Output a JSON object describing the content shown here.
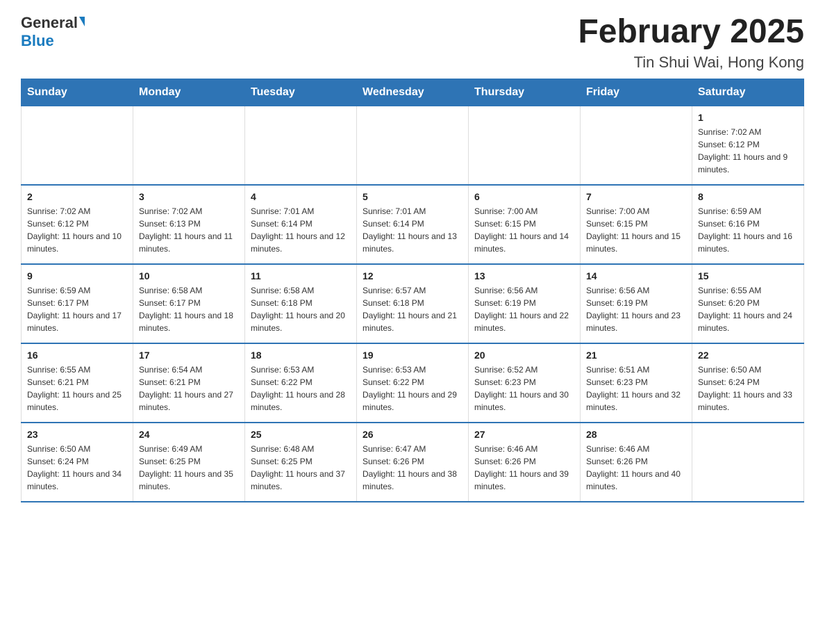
{
  "header": {
    "logo_general": "General",
    "logo_blue": "Blue",
    "title": "February 2025",
    "subtitle": "Tin Shui Wai, Hong Kong"
  },
  "weekdays": [
    "Sunday",
    "Monday",
    "Tuesday",
    "Wednesday",
    "Thursday",
    "Friday",
    "Saturday"
  ],
  "weeks": [
    [
      {
        "day": "",
        "info": ""
      },
      {
        "day": "",
        "info": ""
      },
      {
        "day": "",
        "info": ""
      },
      {
        "day": "",
        "info": ""
      },
      {
        "day": "",
        "info": ""
      },
      {
        "day": "",
        "info": ""
      },
      {
        "day": "1",
        "info": "Sunrise: 7:02 AM\nSunset: 6:12 PM\nDaylight: 11 hours and 9 minutes."
      }
    ],
    [
      {
        "day": "2",
        "info": "Sunrise: 7:02 AM\nSunset: 6:12 PM\nDaylight: 11 hours and 10 minutes."
      },
      {
        "day": "3",
        "info": "Sunrise: 7:02 AM\nSunset: 6:13 PM\nDaylight: 11 hours and 11 minutes."
      },
      {
        "day": "4",
        "info": "Sunrise: 7:01 AM\nSunset: 6:14 PM\nDaylight: 11 hours and 12 minutes."
      },
      {
        "day": "5",
        "info": "Sunrise: 7:01 AM\nSunset: 6:14 PM\nDaylight: 11 hours and 13 minutes."
      },
      {
        "day": "6",
        "info": "Sunrise: 7:00 AM\nSunset: 6:15 PM\nDaylight: 11 hours and 14 minutes."
      },
      {
        "day": "7",
        "info": "Sunrise: 7:00 AM\nSunset: 6:15 PM\nDaylight: 11 hours and 15 minutes."
      },
      {
        "day": "8",
        "info": "Sunrise: 6:59 AM\nSunset: 6:16 PM\nDaylight: 11 hours and 16 minutes."
      }
    ],
    [
      {
        "day": "9",
        "info": "Sunrise: 6:59 AM\nSunset: 6:17 PM\nDaylight: 11 hours and 17 minutes."
      },
      {
        "day": "10",
        "info": "Sunrise: 6:58 AM\nSunset: 6:17 PM\nDaylight: 11 hours and 18 minutes."
      },
      {
        "day": "11",
        "info": "Sunrise: 6:58 AM\nSunset: 6:18 PM\nDaylight: 11 hours and 20 minutes."
      },
      {
        "day": "12",
        "info": "Sunrise: 6:57 AM\nSunset: 6:18 PM\nDaylight: 11 hours and 21 minutes."
      },
      {
        "day": "13",
        "info": "Sunrise: 6:56 AM\nSunset: 6:19 PM\nDaylight: 11 hours and 22 minutes."
      },
      {
        "day": "14",
        "info": "Sunrise: 6:56 AM\nSunset: 6:19 PM\nDaylight: 11 hours and 23 minutes."
      },
      {
        "day": "15",
        "info": "Sunrise: 6:55 AM\nSunset: 6:20 PM\nDaylight: 11 hours and 24 minutes."
      }
    ],
    [
      {
        "day": "16",
        "info": "Sunrise: 6:55 AM\nSunset: 6:21 PM\nDaylight: 11 hours and 25 minutes."
      },
      {
        "day": "17",
        "info": "Sunrise: 6:54 AM\nSunset: 6:21 PM\nDaylight: 11 hours and 27 minutes."
      },
      {
        "day": "18",
        "info": "Sunrise: 6:53 AM\nSunset: 6:22 PM\nDaylight: 11 hours and 28 minutes."
      },
      {
        "day": "19",
        "info": "Sunrise: 6:53 AM\nSunset: 6:22 PM\nDaylight: 11 hours and 29 minutes."
      },
      {
        "day": "20",
        "info": "Sunrise: 6:52 AM\nSunset: 6:23 PM\nDaylight: 11 hours and 30 minutes."
      },
      {
        "day": "21",
        "info": "Sunrise: 6:51 AM\nSunset: 6:23 PM\nDaylight: 11 hours and 32 minutes."
      },
      {
        "day": "22",
        "info": "Sunrise: 6:50 AM\nSunset: 6:24 PM\nDaylight: 11 hours and 33 minutes."
      }
    ],
    [
      {
        "day": "23",
        "info": "Sunrise: 6:50 AM\nSunset: 6:24 PM\nDaylight: 11 hours and 34 minutes."
      },
      {
        "day": "24",
        "info": "Sunrise: 6:49 AM\nSunset: 6:25 PM\nDaylight: 11 hours and 35 minutes."
      },
      {
        "day": "25",
        "info": "Sunrise: 6:48 AM\nSunset: 6:25 PM\nDaylight: 11 hours and 37 minutes."
      },
      {
        "day": "26",
        "info": "Sunrise: 6:47 AM\nSunset: 6:26 PM\nDaylight: 11 hours and 38 minutes."
      },
      {
        "day": "27",
        "info": "Sunrise: 6:46 AM\nSunset: 6:26 PM\nDaylight: 11 hours and 39 minutes."
      },
      {
        "day": "28",
        "info": "Sunrise: 6:46 AM\nSunset: 6:26 PM\nDaylight: 11 hours and 40 minutes."
      },
      {
        "day": "",
        "info": ""
      }
    ]
  ]
}
